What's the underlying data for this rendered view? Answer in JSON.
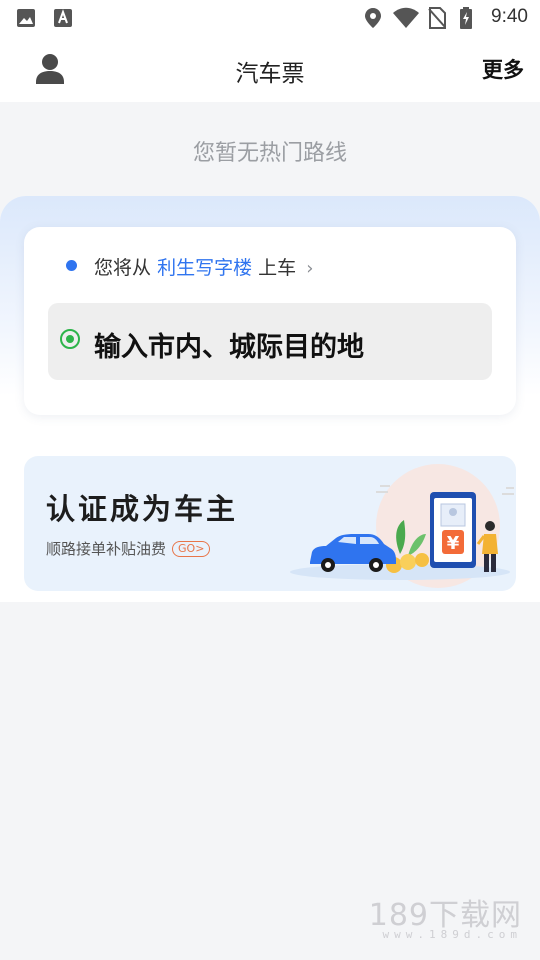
{
  "status_bar": {
    "time": "9:40",
    "left_icons": [
      "image-icon",
      "text-a-icon"
    ],
    "right_icons": [
      "location-icon",
      "wifi-icon",
      "no-sim-icon",
      "battery-charging-icon"
    ]
  },
  "header": {
    "title": "汽车票",
    "more_label": "更多",
    "avatar_icon": "user-icon"
  },
  "hot_routes": {
    "empty_text": "您暂无热门路线"
  },
  "boarding": {
    "prefix": "您将从",
    "pickup_place": "利生写字楼",
    "suffix": "上车",
    "chevron": "›"
  },
  "destination": {
    "placeholder": "输入市内、城际目的地"
  },
  "promo": {
    "title": "认证成为车主",
    "subtitle": "顺路接单补贴油费",
    "go_label": "GO>",
    "currency_symbol": "¥"
  },
  "watermark": {
    "text": "189下载网",
    "sub": "www.189d.com"
  },
  "colors": {
    "accent_blue": "#2f74ef",
    "destination_green": "#2db44a",
    "promo_orange": "#e8764a",
    "promo_bg": "#e9f2fc"
  }
}
